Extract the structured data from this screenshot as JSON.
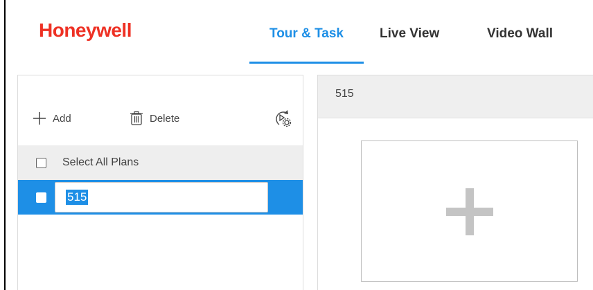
{
  "brand": {
    "logo_text": "Honeywell",
    "logo_color": "#ee3124"
  },
  "nav": {
    "tabs": [
      {
        "label": "Tour & Task",
        "active": true
      },
      {
        "label": "Live View",
        "active": false
      },
      {
        "label": "Video Wall",
        "active": false
      }
    ],
    "accent_color": "#1e8fe6"
  },
  "left_panel": {
    "toolbar": {
      "add_label": "Add",
      "delete_label": "Delete",
      "icons": [
        "plus-icon",
        "trash-icon",
        "play-settings-icon"
      ]
    },
    "select_all_label": "Select All Plans",
    "select_all_checked": false,
    "plans": [
      {
        "name": "515",
        "selected": true,
        "checked": false,
        "editing": true
      }
    ]
  },
  "right_panel": {
    "title": "515",
    "add_tile_icon": "plus-icon"
  }
}
